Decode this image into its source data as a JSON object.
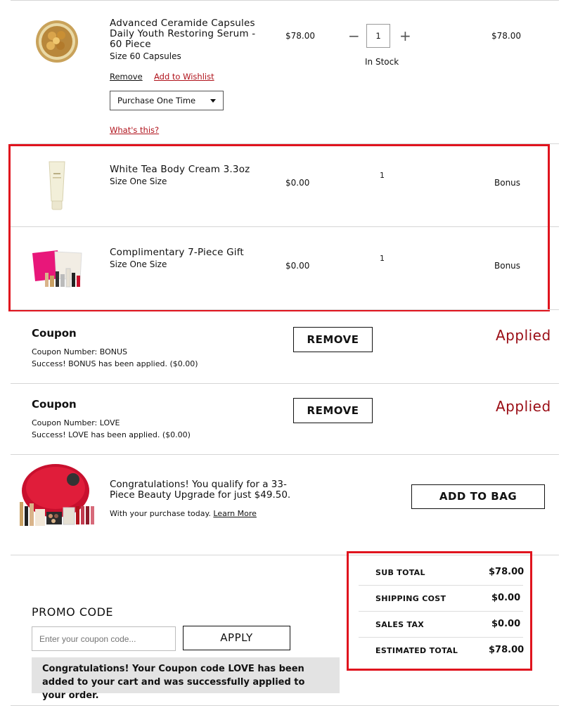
{
  "items": [
    {
      "name": "Advanced Ceramide Capsules Daily Youth Restoring Serum - 60 Piece",
      "size": "Size 60 Capsules",
      "price": "$78.00",
      "quantity": "1",
      "stock": "In Stock",
      "total": "$78.00",
      "remove_label": "Remove",
      "wishlist_label": "Add to Wishlist",
      "purchase_option": "Purchase One Time",
      "whats_this_label": "What's this?"
    },
    {
      "name": "White Tea Body Cream 3.3oz",
      "size": "Size One Size",
      "price": "$0.00",
      "quantity": "1",
      "total": "Bonus"
    },
    {
      "name": "Complimentary 7-Piece Gift",
      "size": "Size One Size",
      "price": "$0.00",
      "quantity": "1",
      "total": "Bonus"
    }
  ],
  "coupons": [
    {
      "title": "Coupon",
      "number": "Coupon Number: BONUS",
      "message": "Success! BONUS has been applied. ($0.00)",
      "button": "REMOVE",
      "status": "Applied"
    },
    {
      "title": "Coupon",
      "number": "Coupon Number: LOVE",
      "message": "Success! LOVE has been applied. ($0.00)",
      "button": "REMOVE",
      "status": "Applied"
    }
  ],
  "upgrade": {
    "text": "Congratulations! You qualify for a 33-Piece Beauty Upgrade for just $49.50.",
    "subtext": "With your purchase today.",
    "learn_more": "Learn More",
    "button": "ADD TO BAG"
  },
  "promo": {
    "title": "PROMO CODE",
    "placeholder": "Enter your coupon code...",
    "apply": "APPLY",
    "message": "Congratulations! Your Coupon code LOVE has been added to your cart and was successfully applied to your order."
  },
  "summary": {
    "subtotal_label": "SUB TOTAL",
    "subtotal": "$78.00",
    "shipping_label": "SHIPPING COST",
    "shipping": "$0.00",
    "tax_label": "SALES TAX",
    "tax": "$0.00",
    "total_label": "ESTIMATED TOTAL",
    "total": "$78.00"
  },
  "colors": {
    "highlight_box": "#e0141e",
    "applied_text": "#9a0c14",
    "link_red": "#b0121b"
  },
  "icons": {
    "minus": "minus-icon",
    "plus": "plus-icon",
    "caret": "chevron-down-icon"
  }
}
